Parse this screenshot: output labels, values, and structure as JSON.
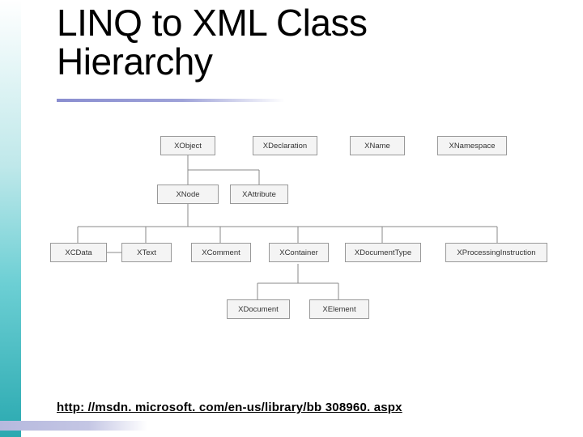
{
  "title": "LINQ to XML Class Hierarchy",
  "link": "http: //msdn. microsoft. com/en-us/library/bb 308960. aspx",
  "diagram": {
    "row1": {
      "xobject": "XObject",
      "xdeclaration": "XDeclaration",
      "xname": "XName",
      "xnamespace": "XNamespace"
    },
    "row2": {
      "xnode": "XNode",
      "xattribute": "XAttribute"
    },
    "row3": {
      "xcdata": "XCData",
      "xtext": "XText",
      "xcomment": "XComment",
      "xcontainer": "XContainer",
      "xdocumenttype": "XDocumentType",
      "xprocessinginstruction": "XProcessingInstruction"
    },
    "row4": {
      "xdocument": "XDocument",
      "xelement": "XElement"
    }
  }
}
